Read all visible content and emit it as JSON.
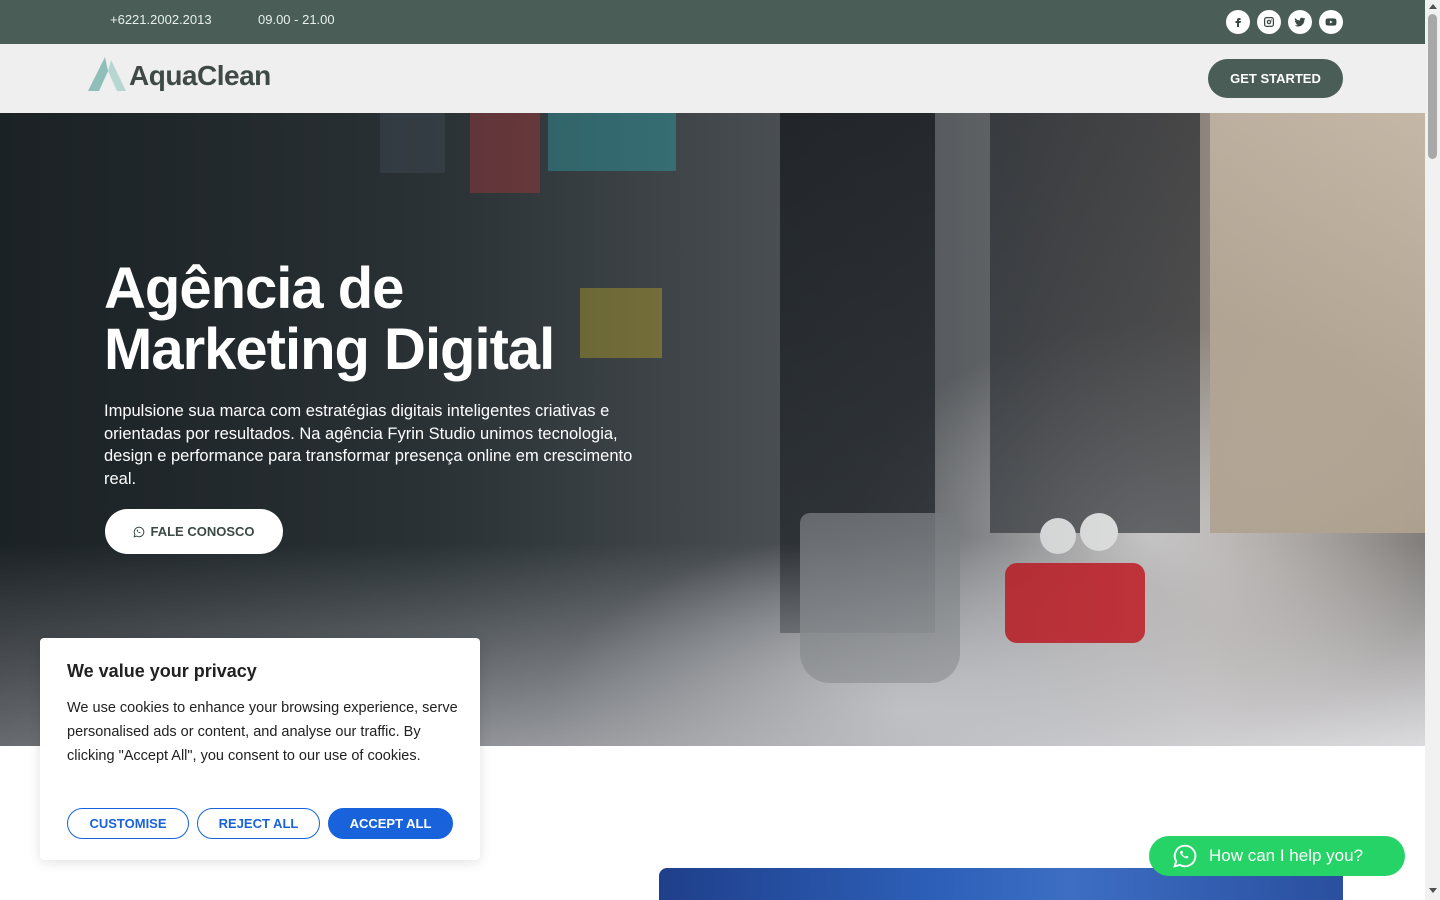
{
  "topbar": {
    "phone": "+6221.2002.2013",
    "hours": "09.00 - 21.00",
    "social": [
      {
        "icon": "facebook-icon"
      },
      {
        "icon": "instagram-icon"
      },
      {
        "icon": "twitter-icon"
      },
      {
        "icon": "youtube-icon"
      }
    ],
    "bg_color": "#4a5e57"
  },
  "header": {
    "logo_text": "AquaClean",
    "cta_label": "GET STARTED",
    "accent_color": "#4a5e57",
    "logo_color": "#8fbfb8"
  },
  "hero": {
    "title_line1": "Agência de",
    "title_line2": "Marketing Digital",
    "lead": "Impulsione sua marca com estratégias digitais inteligentes criativas e orientadas por resultados. Na agência Fyrin Studio unimos tecnologia, design e performance para transformar presença online em crescimento real.",
    "cta_label": "FALE CONOSCO",
    "cta_icon": "whatsapp-icon"
  },
  "cookie": {
    "title": "We value your privacy",
    "text": "We use cookies to enhance your browsing experience, serve personalised ads or content, and analyse our traffic. By clicking \"Accept All\", you consent to our use of cookies.",
    "customise": "CUSTOMISE",
    "reject": "REJECT ALL",
    "accept": "ACCEPT ALL",
    "accent_color": "#1863dc"
  },
  "whatsapp": {
    "label": "How can I help you?",
    "icon": "whatsapp-icon",
    "color": "#25d366"
  }
}
